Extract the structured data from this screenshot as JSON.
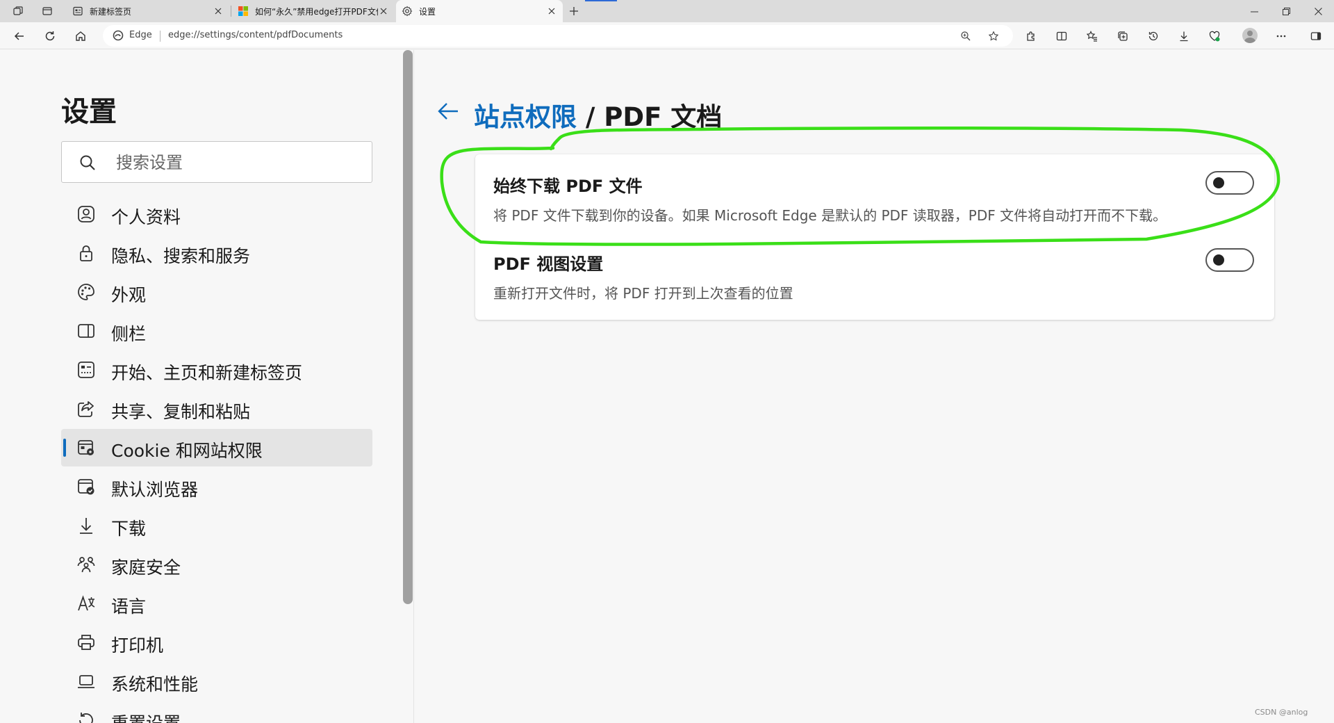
{
  "browser": {
    "tabs": [
      {
        "title": "新建标签页",
        "favicon": "newtab-icon",
        "active": false
      },
      {
        "title": "如何“永久”禁用edge打开PDF文件",
        "favicon": "microsoft-logo",
        "active": false
      },
      {
        "title": "设置",
        "favicon": "gear-icon",
        "active": true
      }
    ],
    "address": {
      "site_label": "Edge",
      "url": "edge://settings/content/pdfDocuments"
    }
  },
  "sidebar": {
    "title": "设置",
    "search_placeholder": "搜索设置",
    "items": [
      {
        "label": "个人资料",
        "icon": "profile-icon",
        "active": false
      },
      {
        "label": "隐私、搜索和服务",
        "icon": "lock-icon",
        "active": false
      },
      {
        "label": "外观",
        "icon": "palette-icon",
        "active": false
      },
      {
        "label": "侧栏",
        "icon": "sidebar-panel-icon",
        "active": false
      },
      {
        "label": "开始、主页和新建标签页",
        "icon": "start-page-icon",
        "active": false
      },
      {
        "label": "共享、复制和粘贴",
        "icon": "share-icon",
        "active": false
      },
      {
        "label": "Cookie 和网站权限",
        "icon": "site-permissions-icon",
        "active": true
      },
      {
        "label": "默认浏览器",
        "icon": "default-browser-icon",
        "active": false
      },
      {
        "label": "下载",
        "icon": "download-icon",
        "active": false
      },
      {
        "label": "家庭安全",
        "icon": "family-icon",
        "active": false
      },
      {
        "label": "语言",
        "icon": "language-icon",
        "active": false
      },
      {
        "label": "打印机",
        "icon": "printer-icon",
        "active": false
      },
      {
        "label": "系统和性能",
        "icon": "laptop-icon",
        "active": false
      },
      {
        "label": "重置设置",
        "icon": "reset-icon",
        "active": false
      }
    ]
  },
  "main": {
    "breadcrumb_link": "站点权限",
    "breadcrumb_sep": " / ",
    "breadcrumb_current": "PDF 文档",
    "settings": [
      {
        "title": "始终下载 PDF 文件",
        "description": "将 PDF 文件下载到你的设备。如果 Microsoft Edge 是默认的 PDF 读取器，PDF 文件将自动打开而不下载。",
        "enabled": false
      },
      {
        "title": "PDF 视图设置",
        "description": "重新打开文件时，将 PDF 打开到上次查看的位置",
        "enabled": false
      }
    ]
  },
  "watermark": "CSDN @anlog",
  "colors": {
    "accent": "#0f6cbd",
    "annotation": "#3adf18"
  }
}
